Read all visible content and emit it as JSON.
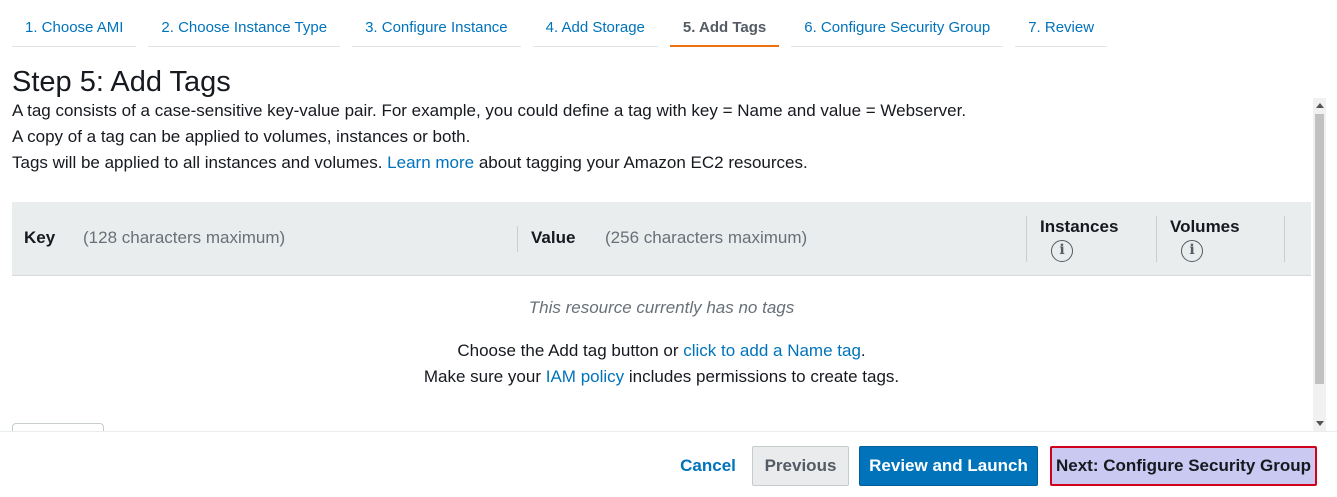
{
  "wizard": {
    "steps": [
      {
        "label": "1. Choose AMI"
      },
      {
        "label": "2. Choose Instance Type"
      },
      {
        "label": "3. Configure Instance"
      },
      {
        "label": "4. Add Storage"
      },
      {
        "label": "5. Add Tags"
      },
      {
        "label": "6. Configure Security Group"
      },
      {
        "label": "7. Review"
      }
    ],
    "active_step": 5
  },
  "page": {
    "title": "Step 5: Add Tags",
    "intro_line1": "A tag consists of a case-sensitive key-value pair. For example, you could define a tag with key = Name and value = Webserver.",
    "intro_line2": "A copy of a tag can be applied to volumes, instances or both.",
    "intro_line3_pre": "Tags will be applied to all instances and volumes.",
    "intro_line3_link": "Learn more",
    "intro_line3_post": "about tagging your Amazon EC2 resources."
  },
  "table": {
    "key_header": "Key",
    "key_hint": "(128 characters maximum)",
    "value_header": "Value",
    "value_hint": "(256 characters maximum)",
    "instances_header": "Instances",
    "volumes_header": "Volumes",
    "info_glyph": "i"
  },
  "empty_state": {
    "message": "This resource currently has no tags",
    "line1_pre": "Choose the Add tag button or",
    "line1_link": "click to add a Name tag",
    "line1_post": ".",
    "line2_pre": "Make sure your",
    "line2_link": "IAM policy",
    "line2_post": "includes permissions to create tags."
  },
  "footer": {
    "cancel_label": "Cancel",
    "previous_label": "Previous",
    "review_label": "Review and Launch",
    "next_label": "Next: Configure Security Group"
  },
  "colors": {
    "link": "#0073bb",
    "active_tab_underline": "#ec7211",
    "primary_button": "#0073bb",
    "highlight_border": "#d0021b"
  }
}
